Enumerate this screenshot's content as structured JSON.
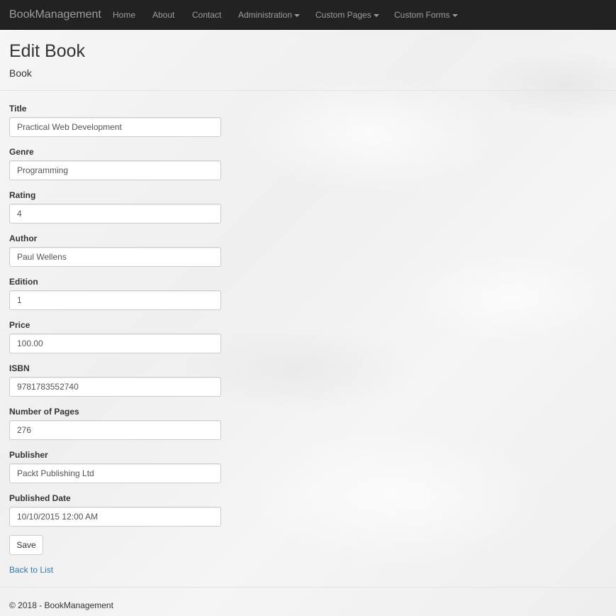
{
  "navbar": {
    "brand": "BookManagement",
    "items": [
      {
        "label": "Home",
        "dropdown": false
      },
      {
        "label": "About",
        "dropdown": false
      },
      {
        "label": "Contact",
        "dropdown": false
      },
      {
        "label": "Administration",
        "dropdown": true
      },
      {
        "label": "Custom Pages",
        "dropdown": true
      },
      {
        "label": "Custom Forms",
        "dropdown": true
      }
    ]
  },
  "page": {
    "title": "Edit Book",
    "subtitle": "Book"
  },
  "form": {
    "fields": [
      {
        "label": "Title",
        "value": "Practical Web Development"
      },
      {
        "label": "Genre",
        "value": "Programming"
      },
      {
        "label": "Rating",
        "value": "4"
      },
      {
        "label": "Author",
        "value": "Paul Wellens"
      },
      {
        "label": "Edition",
        "value": "1"
      },
      {
        "label": "Price",
        "value": "100.00"
      },
      {
        "label": "ISBN",
        "value": "9781783552740"
      },
      {
        "label": "Number of Pages",
        "value": "276"
      },
      {
        "label": "Publisher",
        "value": "Packt Publishing Ltd"
      },
      {
        "label": "Published Date",
        "value": "10/10/2015 12:00 AM"
      }
    ],
    "save_label": "Save"
  },
  "links": {
    "back_to_list": "Back to List"
  },
  "footer": {
    "text": "© 2018 - BookManagement"
  },
  "colors": {
    "navbar_bg": "#222222",
    "nav_text": "#9d9d9d",
    "link": "#337ab7"
  }
}
